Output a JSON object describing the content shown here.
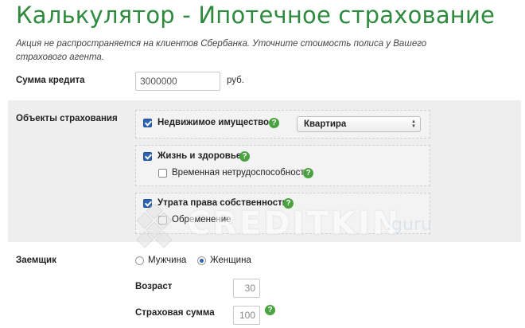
{
  "page": {
    "title": "Калькулятор - Ипотечное страхование",
    "note": "Акция не распространяется на клиентов Сбербанка. Уточните стоимость полиса у Вашего страхового агента."
  },
  "loan": {
    "label": "Сумма кредита",
    "value": "3000000",
    "unit": "руб."
  },
  "insurance": {
    "label": "Объекты страхования",
    "property": {
      "label": "Недвижимое имущество",
      "checked": true,
      "select_value": "Квартира"
    },
    "life": {
      "label": "Жизнь и здоровье",
      "checked": true
    },
    "disability": {
      "label": "Временная нетрудоспособность",
      "checked": false
    },
    "title_loss": {
      "label": "Утрата права собственности",
      "checked": true
    },
    "encumbrance": {
      "label": "Обременение",
      "checked": false
    }
  },
  "borrower": {
    "label": "Заемщик",
    "options": [
      "Мужчина",
      "Женщина"
    ],
    "selected": "Женщина",
    "age_label": "Возраст",
    "age_value": "30",
    "sum_label": "Страховая сумма",
    "sum_value": "100"
  },
  "help_glyph": "?",
  "watermark": {
    "brand": "CREDITKIN",
    "suffix": ".guru"
  },
  "colors": {
    "title_green": "#2e8b3e",
    "help_green": "#4aa33f",
    "checkbox_blue": "#2c63b5"
  }
}
